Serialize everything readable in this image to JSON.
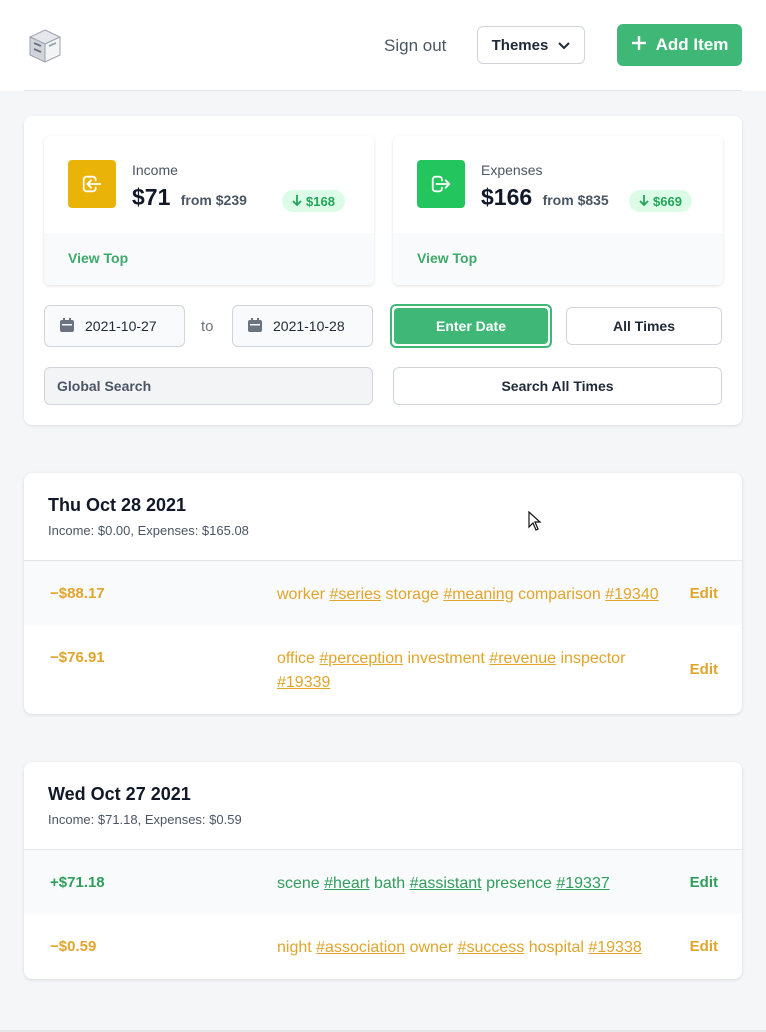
{
  "header": {
    "signout_label": "Sign out",
    "themes_label": "Themes",
    "add_item_label": "Add Item"
  },
  "summary": {
    "income": {
      "label": "Income",
      "value": "$71",
      "from": "from $239",
      "change": "$168",
      "view_top": "View Top",
      "icon": "sign-in-icon",
      "color": "#eab308"
    },
    "expenses": {
      "label": "Expenses",
      "value": "$166",
      "from": "from $835",
      "change": "$669",
      "view_top": "View Top",
      "icon": "sign-out-icon",
      "color": "#22c55e"
    }
  },
  "filters": {
    "date_from": "2021-10-27",
    "to_label": "to",
    "date_to": "2021-10-28",
    "enter_date_label": "Enter Date",
    "all_times_label": "All Times",
    "search_placeholder": "Global Search",
    "search_all_label": "Search All Times"
  },
  "days": [
    {
      "title": "Thu Oct 28 2021",
      "summary": "Income: $0.00, Expenses: $165.08",
      "transactions": [
        {
          "sign": "−",
          "amount": "$88.17",
          "type": "expense",
          "parts": [
            {
              "text": "worker",
              "tag": false
            },
            {
              "text": "#series",
              "tag": true
            },
            {
              "text": "storage",
              "tag": false
            },
            {
              "text": "#meaning",
              "tag": true
            },
            {
              "text": "comparison",
              "tag": false
            },
            {
              "text": "#19340",
              "tag": true
            }
          ],
          "edit_label": "Edit"
        },
        {
          "sign": "−",
          "amount": "$76.91",
          "type": "expense",
          "parts": [
            {
              "text": "office",
              "tag": false
            },
            {
              "text": "#perception",
              "tag": true
            },
            {
              "text": "investment",
              "tag": false
            },
            {
              "text": "#revenue",
              "tag": true
            },
            {
              "text": "inspector",
              "tag": false
            },
            {
              "text": "#19339",
              "tag": true
            }
          ],
          "edit_label": "Edit"
        }
      ]
    },
    {
      "title": "Wed Oct 27 2021",
      "summary": "Income: $71.18, Expenses: $0.59",
      "transactions": [
        {
          "sign": "+",
          "amount": "$71.18",
          "type": "income",
          "parts": [
            {
              "text": "scene",
              "tag": false
            },
            {
              "text": "#heart",
              "tag": true
            },
            {
              "text": "bath",
              "tag": false
            },
            {
              "text": "#assistant",
              "tag": true
            },
            {
              "text": "presence",
              "tag": false
            },
            {
              "text": "#19337",
              "tag": true
            }
          ],
          "edit_label": "Edit"
        },
        {
          "sign": "−",
          "amount": "$0.59",
          "type": "expense",
          "parts": [
            {
              "text": "night",
              "tag": false
            },
            {
              "text": "#association",
              "tag": true
            },
            {
              "text": "owner",
              "tag": false
            },
            {
              "text": "#success",
              "tag": true
            },
            {
              "text": "hospital",
              "tag": false
            },
            {
              "text": "#19338",
              "tag": true
            }
          ],
          "edit_label": "Edit"
        }
      ]
    }
  ],
  "colors": {
    "accent": "#3fb877",
    "expense": "#e0a52a",
    "income": "#2f9e5c"
  }
}
